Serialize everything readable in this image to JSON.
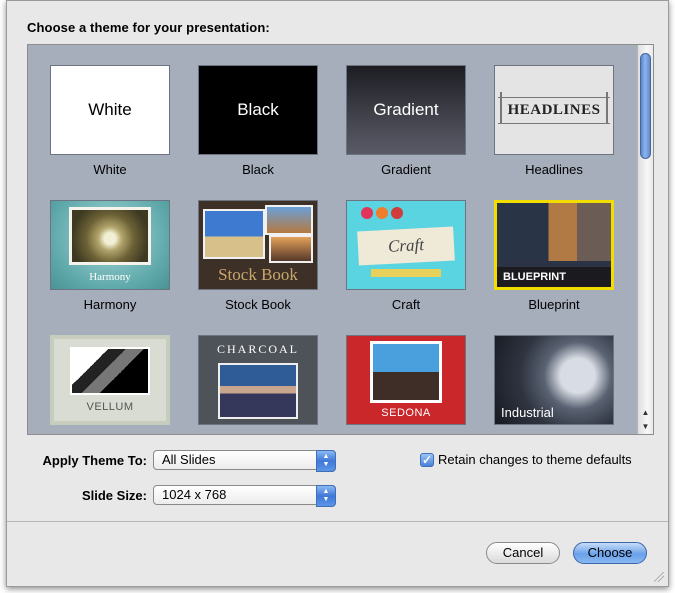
{
  "dialog": {
    "heading": "Choose a theme for your presentation:"
  },
  "themes": [
    {
      "name": "White",
      "thumb_text": "White"
    },
    {
      "name": "Black",
      "thumb_text": "Black"
    },
    {
      "name": "Gradient",
      "thumb_text": "Gradient"
    },
    {
      "name": "Headlines",
      "thumb_text": "HEADLINES"
    },
    {
      "name": "Harmony",
      "thumb_text": "Harmony"
    },
    {
      "name": "Stock Book",
      "thumb_text": "Stock Book"
    },
    {
      "name": "Craft",
      "thumb_text": "Craft"
    },
    {
      "name": "Blueprint",
      "thumb_text": "BLUEPRINT"
    },
    {
      "name": "Vellum",
      "thumb_text": "VELLUM"
    },
    {
      "name": "Charcoal",
      "thumb_text": "CHARCOAL"
    },
    {
      "name": "Sedona",
      "thumb_text": "SEDONA"
    },
    {
      "name": "Industrial",
      "thumb_text": "Industrial"
    }
  ],
  "selected_theme": "Blueprint",
  "options": {
    "apply_label": "Apply Theme To:",
    "apply_value": "All Slides",
    "size_label": "Slide Size:",
    "size_value": "1024 x 768",
    "retain_label": "Retain changes to theme defaults",
    "retain_checked": true
  },
  "buttons": {
    "cancel": "Cancel",
    "choose": "Choose"
  },
  "colors": {
    "selection": "#f2dd00",
    "accent": "#5a86c9"
  }
}
